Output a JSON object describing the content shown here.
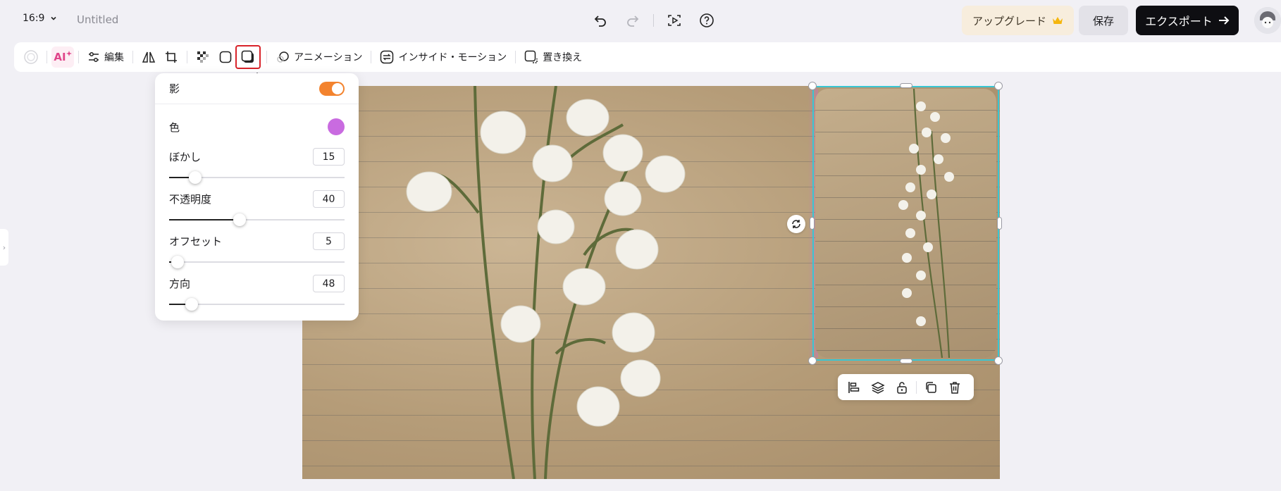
{
  "header": {
    "aspect_ratio": "16:9",
    "doc_title": "Untitled",
    "upgrade_label": "アップグレード",
    "save_label": "保存",
    "export_label": "エクスポート"
  },
  "toolbar": {
    "ai_label": "AI",
    "edit_label": "編集",
    "animation_label": "アニメーション",
    "inside_motion_label": "インサイド・モーション",
    "replace_label": "置き換え",
    "shadow_tooltip": "影"
  },
  "shadow_panel": {
    "title": "影",
    "enabled": true,
    "color_label": "色",
    "color_value": "#c96be0",
    "props": [
      {
        "label": "ぼかし",
        "value": "15",
        "fraction": 0.15
      },
      {
        "label": "不透明度",
        "value": "40",
        "fraction": 0.4
      },
      {
        "label": "オフセット",
        "value": "5",
        "fraction": 0.05
      },
      {
        "label": "方向",
        "value": "48",
        "fraction": 0.13
      }
    ]
  },
  "colors": {
    "accent_toggle": "#f3832e",
    "selection": "#39c6d3",
    "export_bg": "#0e0e12",
    "upgrade_bg": "#f7eddd"
  }
}
